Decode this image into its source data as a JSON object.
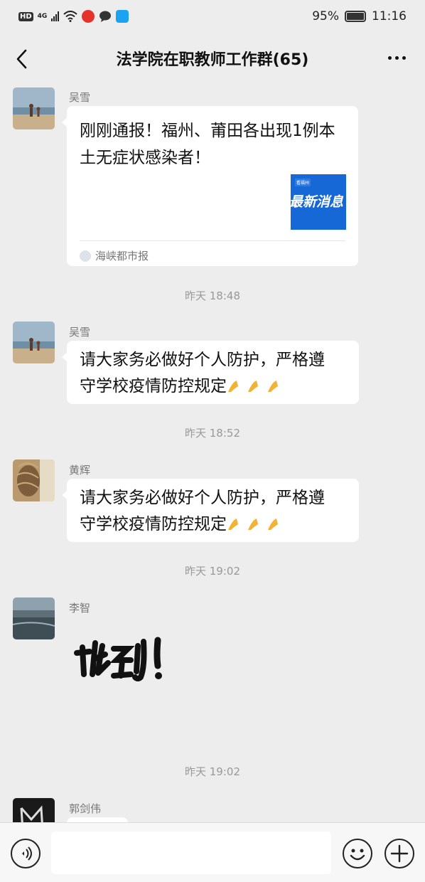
{
  "status_bar": {
    "hd": "HD",
    "network": "4G",
    "battery": "95%",
    "time": "11:16",
    "icons": [
      "hd-icon",
      "signal-icon",
      "wifi-icon",
      "weibo-icon",
      "message-icon",
      "search-app-icon",
      "leaf-icon",
      "battery-icon"
    ]
  },
  "navbar": {
    "title": "法学院在职教师工作群(65)",
    "back_icon": "chevron-left-icon",
    "more_icon": "more-dots-icon"
  },
  "messages": [
    {
      "sender": "吴雪",
      "type": "card",
      "title": "刚刚通报！福州、莆田各出现1例本土无症状感染者！",
      "thumb_tag": "看福州",
      "thumb_text": "最新消息",
      "source": "海峡都市报"
    },
    {
      "time": "昨天 18:48"
    },
    {
      "sender": "吴雪",
      "type": "text",
      "line1": "请大家务必做好个人防护，严格遵",
      "line2": "守学校疫情防控规定",
      "emoji": "pray-emoji-x3"
    },
    {
      "time": "昨天 18:52"
    },
    {
      "sender": "黄辉",
      "type": "text",
      "line1": "请大家务必做好个人防护，严格遵",
      "line2": "守学校疫情防控规定",
      "emoji": "pray-emoji-x3"
    },
    {
      "time": "昨天 19:02"
    },
    {
      "sender": "李智",
      "type": "sticker",
      "sticker_text": "收到!"
    },
    {
      "time": "昨天 19:02"
    },
    {
      "sender": "郭剑伟",
      "type": "text"
    }
  ],
  "input_bar": {
    "voice_icon": "voice-icon",
    "emoji_icon": "smiley-icon",
    "plus_icon": "plus-icon",
    "placeholder": ""
  }
}
